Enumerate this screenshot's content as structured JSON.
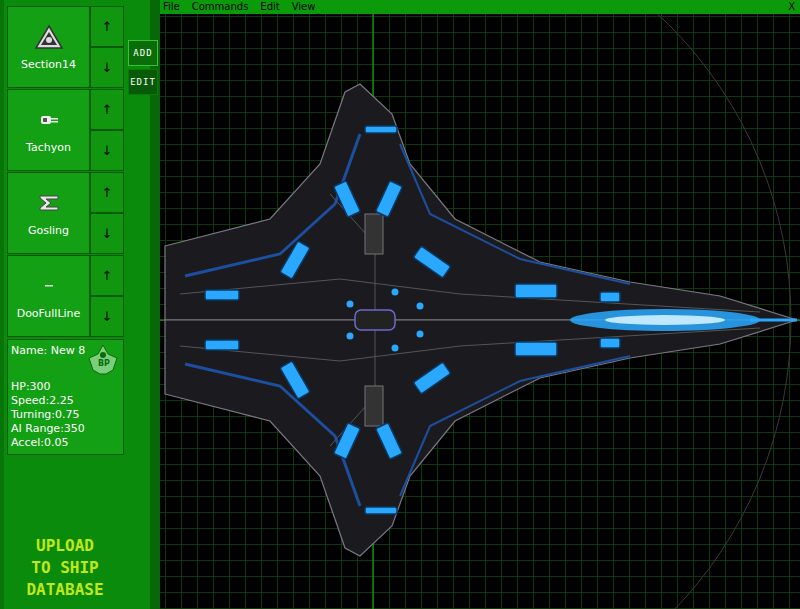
{
  "menu": [
    {
      "label": "File"
    },
    {
      "label": "Commands"
    },
    {
      "label": "Edit"
    },
    {
      "label": "View"
    }
  ],
  "close": "X",
  "parts": [
    {
      "name": "Section14",
      "kind": "section",
      "up": "↑",
      "down": "↓"
    },
    {
      "name": "Tachyon",
      "kind": "weapon",
      "up": "↑",
      "down": "↓"
    },
    {
      "name": "Gosling",
      "kind": "engine",
      "up": "↑",
      "down": "↓"
    },
    {
      "name": "DooFullLine",
      "kind": "line",
      "up": "↑",
      "down": "↓"
    }
  ],
  "tabs": [
    {
      "label": "ADD",
      "selected": true
    },
    {
      "label": "EDIT",
      "selected": false
    }
  ],
  "ship": {
    "name": "Name: New 8",
    "badge": "BP",
    "stats": [
      "HP:300",
      "Speed:2.25",
      "Turning:0.75",
      "AI Range:350",
      "Accel:0.05"
    ]
  },
  "upload": {
    "lines": [
      "UPLOAD",
      "TO SHIP",
      "DATABASE"
    ]
  }
}
